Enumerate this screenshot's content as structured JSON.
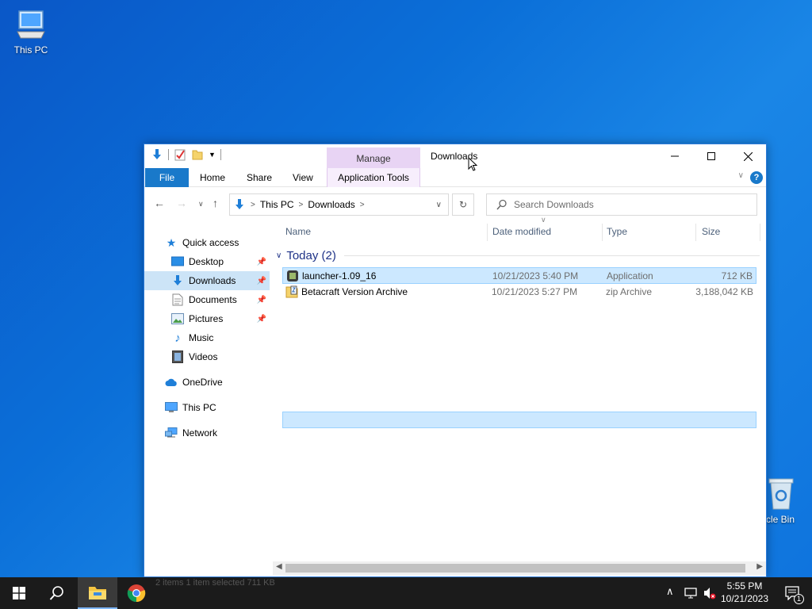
{
  "desktop": {
    "this_pc_label": "This PC",
    "recycle_bin_label": "ycle Bin"
  },
  "window": {
    "title": "Downloads",
    "manage_tab": "Manage",
    "ribbon_tabs": [
      "File",
      "Home",
      "Share",
      "View",
      "Application Tools"
    ],
    "help_label": "?",
    "address": {
      "crumbs": [
        "This PC",
        "Downloads"
      ]
    },
    "search": {
      "placeholder": "Search Downloads"
    }
  },
  "navigation": {
    "items": [
      {
        "label": "Quick access",
        "icon": "star-icon"
      },
      {
        "label": "Desktop",
        "icon": "desktop-icon",
        "pinned": true
      },
      {
        "label": "Downloads",
        "icon": "download-arrow-icon",
        "pinned": true,
        "selected": true
      },
      {
        "label": "Documents",
        "icon": "document-icon",
        "pinned": true
      },
      {
        "label": "Pictures",
        "icon": "pictures-icon",
        "pinned": true
      },
      {
        "label": "Music",
        "icon": "music-note-icon"
      },
      {
        "label": "Videos",
        "icon": "film-icon"
      },
      {
        "label": "OneDrive",
        "icon": "cloud-icon"
      },
      {
        "label": "This PC",
        "icon": "computer-icon"
      },
      {
        "label": "Network",
        "icon": "network-icon"
      }
    ]
  },
  "file_list": {
    "columns": [
      "Name",
      "Date modified",
      "Type",
      "Size"
    ],
    "group_title": "Today (2)",
    "rows": [
      {
        "name": "launcher-1.09_16",
        "date": "10/21/2023 5:40 PM",
        "type": "Application",
        "size": "712 KB",
        "selected": true,
        "icon": "application-icon"
      },
      {
        "name": "Betacraft Version Archive",
        "date": "10/21/2023 5:27 PM",
        "type": "zip Archive",
        "size": "3,188,042 KB",
        "selected": false,
        "icon": "zip-archive-icon"
      }
    ]
  },
  "status_bar": {
    "ghost_text": "2 items     1 item selected  711 KB"
  },
  "taskbar": {
    "time": "5:55 PM",
    "date": "10/21/2023",
    "notification_count": "1"
  },
  "colors": {
    "accent": "#1979ca",
    "selection": "#cce8ff",
    "manage_tab": "#e8d4f4"
  }
}
